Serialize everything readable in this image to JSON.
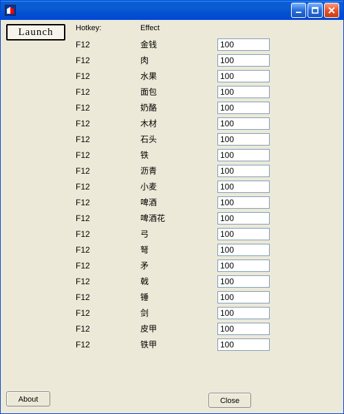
{
  "window": {
    "title": ""
  },
  "buttons": {
    "launch": "Launch",
    "about": "About",
    "close": "Close"
  },
  "headers": {
    "hotkey": "Hotkey:",
    "effect": "Effect"
  },
  "rows": [
    {
      "hotkey": "F12",
      "effect": "金钱",
      "value": "100"
    },
    {
      "hotkey": "F12",
      "effect": "肉",
      "value": "100"
    },
    {
      "hotkey": "F12",
      "effect": "水果",
      "value": "100"
    },
    {
      "hotkey": "F12",
      "effect": "面包",
      "value": "100"
    },
    {
      "hotkey": "F12",
      "effect": "奶酪",
      "value": "100"
    },
    {
      "hotkey": "F12",
      "effect": "木材",
      "value": "100"
    },
    {
      "hotkey": "F12",
      "effect": "石头",
      "value": "100"
    },
    {
      "hotkey": "F12",
      "effect": "铁",
      "value": "100"
    },
    {
      "hotkey": "F12",
      "effect": "沥青",
      "value": "100"
    },
    {
      "hotkey": "F12",
      "effect": "小麦",
      "value": "100"
    },
    {
      "hotkey": "F12",
      "effect": "啤酒",
      "value": "100"
    },
    {
      "hotkey": "F12",
      "effect": "啤酒花",
      "value": "100"
    },
    {
      "hotkey": "F12",
      "effect": "弓",
      "value": "100"
    },
    {
      "hotkey": "F12",
      "effect": "弩",
      "value": "100"
    },
    {
      "hotkey": "F12",
      "effect": "矛",
      "value": "100"
    },
    {
      "hotkey": "F12",
      "effect": "戟",
      "value": "100"
    },
    {
      "hotkey": "F12",
      "effect": "锤",
      "value": "100"
    },
    {
      "hotkey": "F12",
      "effect": "剑",
      "value": "100"
    },
    {
      "hotkey": "F12",
      "effect": "皮甲",
      "value": "100"
    },
    {
      "hotkey": "F12",
      "effect": "铁甲",
      "value": "100"
    }
  ]
}
